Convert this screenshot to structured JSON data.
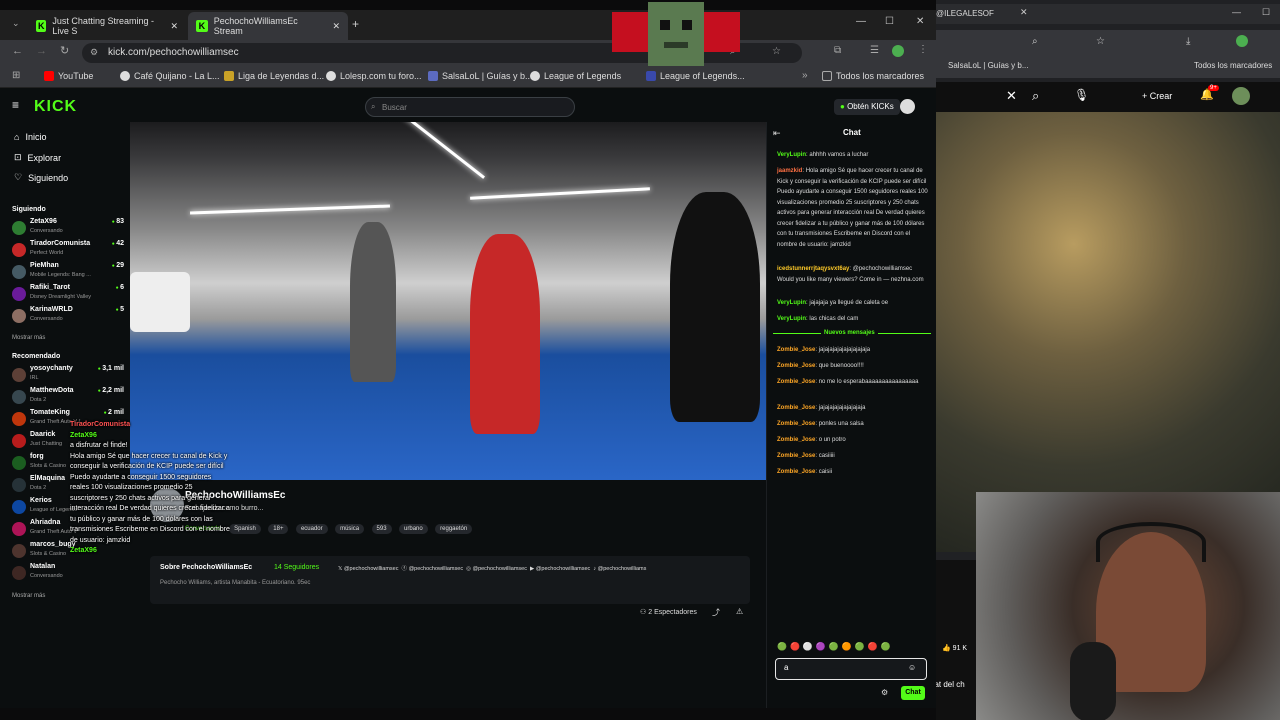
{
  "tabs": [
    {
      "label": "Just Chatting Streaming - Live S"
    },
    {
      "label": "PechochoWilliamsEc Stream"
    }
  ],
  "url": "kick.com/pechochowilliamsec",
  "bookmarks": [
    "YouTube",
    "Café Quijano - La L...",
    "Liga de Leyendas d...",
    "Lolesp.com tu foro...",
    "SalsaLoL | Guías y b...",
    "League of Legends",
    "League of Legends..."
  ],
  "bookmarks_all": "Todos los marcadores",
  "right_browser": {
    "tab_label": "@ILEGALESOF",
    "bookmark": "SalsaLoL | Guías y b...",
    "bookmarks_all": "Todos los marcadores",
    "create": "Crear",
    "notif": "9+",
    "likes": "91 K",
    "side_text": "chat del ch"
  },
  "kick": {
    "logo": "KICK",
    "search_placeholder": "Buscar",
    "obtain": "Obtén KICKs",
    "nav": [
      {
        "label": "Inicio"
      },
      {
        "label": "Explorar"
      },
      {
        "label": "Siguiendo"
      }
    ],
    "following_title": "Siguiendo",
    "following": [
      {
        "name": "ZetaX96",
        "cat": "Conversando",
        "viewers": "83",
        "color": "#2e7d32"
      },
      {
        "name": "TiradorComunista",
        "cat": "Perfect World",
        "viewers": "42",
        "color": "#c62828"
      },
      {
        "name": "PieMhan",
        "cat": "Mobile Legends: Bang ...",
        "viewers": "29",
        "color": "#455a64"
      },
      {
        "name": "Rafiki_Tarot",
        "cat": "Disney Dreamlight Valley",
        "viewers": "6",
        "color": "#6a1b9a"
      },
      {
        "name": "KarinaWRLD",
        "cat": "Conversando",
        "viewers": "5",
        "color": "#8d6e63"
      }
    ],
    "show_more": "Mostrar más",
    "recommended_title": "Recomendado",
    "recommended": [
      {
        "name": "yosoychanty",
        "cat": "IRL",
        "viewers": "3,1 mil",
        "color": "#5d4037"
      },
      {
        "name": "MatthewDota",
        "cat": "Dota 2",
        "viewers": "2,2 mil",
        "color": "#37474f"
      },
      {
        "name": "TomateKing",
        "cat": "Grand Theft Auto V (...",
        "viewers": "2 mil",
        "color": "#bf360c"
      },
      {
        "name": "Daarick",
        "cat": "Just Chatting",
        "viewers": "",
        "color": "#b71c1c"
      },
      {
        "name": "forg",
        "cat": "Slots & Casino",
        "viewers": "",
        "color": "#1b5e20"
      },
      {
        "name": "ElMaquina",
        "cat": "Dota 2",
        "viewers": "",
        "color": "#263238"
      },
      {
        "name": "Kerios",
        "cat": "League of Legends",
        "viewers": "",
        "color": "#0d47a1"
      },
      {
        "name": "Ahriadna",
        "cat": "Grand Theft Auto V",
        "viewers": "",
        "color": "#ad1457"
      },
      {
        "name": "marcos_bugy",
        "cat": "Slots & Casino",
        "viewers": "",
        "color": "#4e342e"
      },
      {
        "name": "Natalan",
        "cat": "Conversando",
        "viewers": "",
        "color": "#3e2723"
      }
    ],
    "show_more_2": "Mostrar más",
    "streamer": "PechochoWilliamsEc",
    "stream_title": "Trabajando como burro...",
    "category": "Conversando",
    "tags": [
      "Spanish",
      "18+",
      "ecuador",
      "música",
      "593",
      "urbano",
      "reggaetón"
    ],
    "viewers_label": "2 Espectadores",
    "about_title": "Sobre PechochoWilliamsEc",
    "followers": "14 Seguidores",
    "bio": "Pechocho Williams, artista Manabita - Ecuatoriano. 95ec",
    "socials": [
      "@pechochowilliamsec",
      "@pechochowilliamsec",
      "@pechochowilliamsec",
      "@pechochowilliamsec",
      "@pechochowilliams"
    ]
  },
  "chat": {
    "title": "Chat",
    "messages": [
      {
        "user": "VeryLupin",
        "color": "#53fc18",
        "text": "ahhhh vamos a luchar"
      },
      {
        "user": "jaamzkid",
        "color": "#ff7043",
        "text": "Hola amigo Sé que hacer crecer tu canal de Kick y conseguir la verificación de KCIP puede ser difícil Puedo ayudarte a conseguir 1500 seguidores reales 100 visualizaciones promedio 25 suscriptores y 250 chats activos para generar interacción real De verdad quieres crecer fidelizar a tu público y ganar más de 100 dólares con tu transmisiones Escribeme en Discord con el nombre de usuario: jamzkid"
      },
      {
        "user": "icedstunnerrjtaqysvxt6ay",
        "color": "#ffca28",
        "text": "@pechochowilliamsec Would you like many viewers? Come in — nezhna.com"
      },
      {
        "user": "VeryLupin",
        "color": "#53fc18",
        "text": "jajajaja ya llegué de caleta oe"
      },
      {
        "user": "VeryLupin",
        "color": "#53fc18",
        "text": "las chicas del cam"
      }
    ],
    "new_messages": "Nuevos mensajes",
    "messages2": [
      {
        "user": "Zombie_Jose",
        "color": "#ffa726",
        "text": "jajajajajajajajajajaja"
      },
      {
        "user": "Zombie_Jose",
        "color": "#ffa726",
        "text": "que buenoooo!!!!"
      },
      {
        "user": "Zombie_Jose",
        "color": "#ffa726",
        "text": "no me lo esperabaaaaaaaaaaaaaaaa"
      },
      {
        "user": "Zombie_Jose",
        "color": "#ffa726",
        "text": "jajajajajajajajajaja"
      },
      {
        "user": "Zombie_Jose",
        "color": "#ffa726",
        "text": "ponles una salsa"
      },
      {
        "user": "Zombie_Jose",
        "color": "#ffa726",
        "text": "o un potro"
      },
      {
        "user": "Zombie_Jose",
        "color": "#ffa726",
        "text": "casiiiii"
      },
      {
        "user": "Zombie_Jose",
        "color": "#ffa726",
        "text": "caisii"
      }
    ],
    "input_value": "a",
    "send": "Chat"
  },
  "overlay": {
    "lines": [
      "TiradorComunista",
      "ZetaX96",
      "a disfrutar el finde!",
      "Hola amigo Sé que hacer crecer tu canal de Kick y conseguir la verificación de KCIP puede ser difícil Puedo ayudarte a conseguir 1500 seguidores reales 100 visualizaciones promedio 25 suscriptores y 250 chats activos para generar interacción real De verdad quieres crecer fidelizar a tu público y ganar más de 100 dólares con las transmisiones Escribeme en Discord con el nombre de usuario: jamzkid",
      "ZetaX96"
    ]
  }
}
